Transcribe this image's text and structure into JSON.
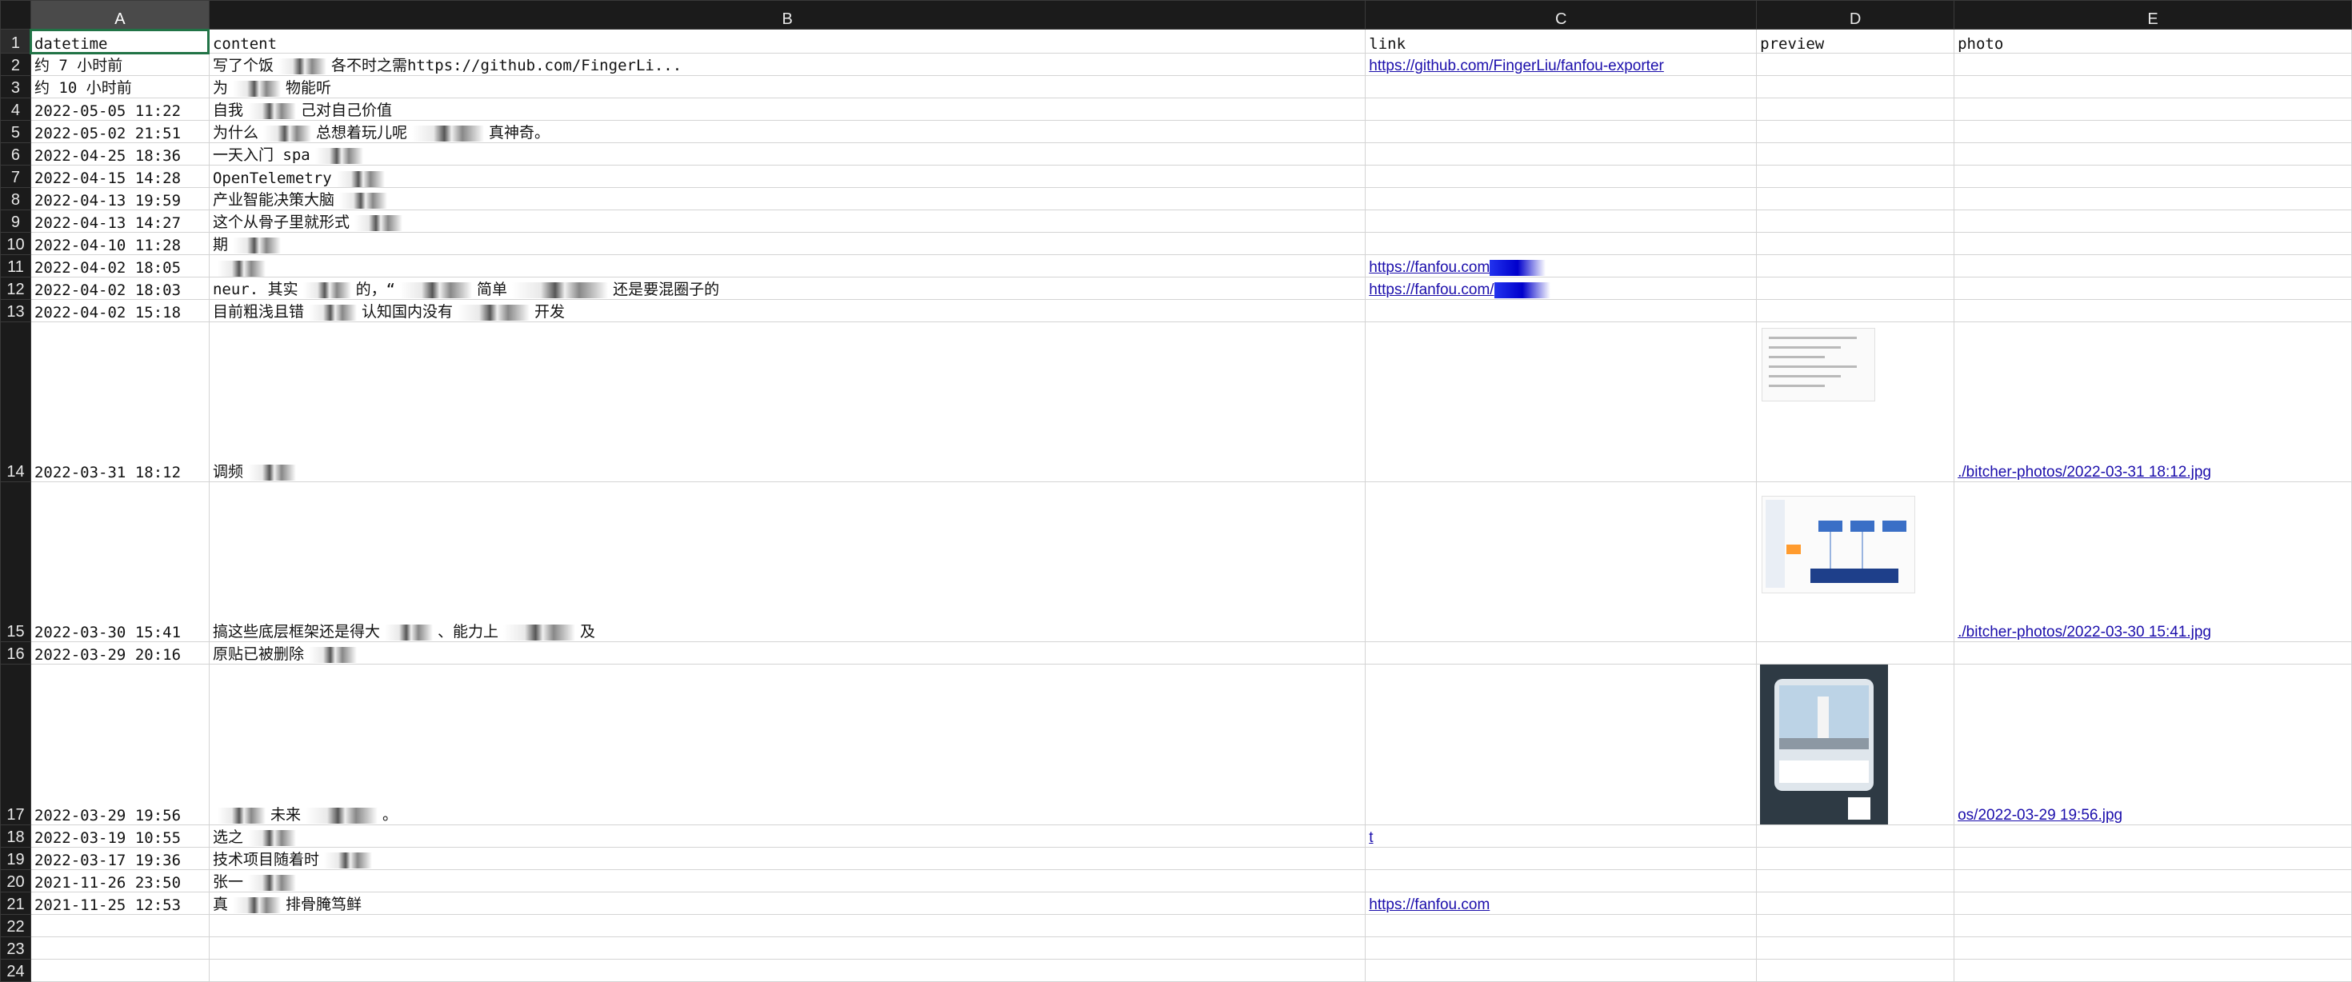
{
  "columns": [
    "A",
    "B",
    "C",
    "D",
    "E"
  ],
  "headers": [
    "datetime",
    "content",
    "link",
    "preview",
    "photo"
  ],
  "rows": [
    {
      "num": "2",
      "datetime": "约 7 小时前",
      "content": "写了个饭",
      "content_tail": "各不时之需https://github.com/FingerLi...",
      "link": "https://github.com/FingerLiu/fanfou-exporter",
      "photo": ""
    },
    {
      "num": "3",
      "datetime": "约 10 小时前",
      "content": "为",
      "content_tail": "物能听",
      "link": "",
      "photo": ""
    },
    {
      "num": "4",
      "datetime": "2022-05-05 11:22",
      "content": "自我",
      "content_tail": "己对自己价值",
      "link": "",
      "photo": ""
    },
    {
      "num": "5",
      "datetime": "2022-05-02 21:51",
      "content": "为什么",
      "content_tail": "总想着玩儿呢",
      "content_tail2": "真神奇。",
      "link": "",
      "photo": ""
    },
    {
      "num": "6",
      "datetime": "2022-04-25 18:36",
      "content": "一天入门 spa",
      "content_tail": "",
      "link": "",
      "photo": ""
    },
    {
      "num": "7",
      "datetime": "2022-04-15 14:28",
      "content": "OpenTelemetry",
      "content_tail": "",
      "link": "",
      "photo": ""
    },
    {
      "num": "8",
      "datetime": "2022-04-13 19:59",
      "content": "产业智能决策大脑",
      "content_tail": "",
      "link": "",
      "photo": ""
    },
    {
      "num": "9",
      "datetime": "2022-04-13 14:27",
      "content": "这个从骨子里就形式",
      "content_tail": "",
      "link": "",
      "photo": ""
    },
    {
      "num": "10",
      "datetime": "2022-04-10 11:28",
      "content": "期",
      "content_tail": "",
      "link": "",
      "photo": ""
    },
    {
      "num": "11",
      "datetime": "2022-04-02 18:05",
      "content": "",
      "content_tail": "",
      "link": "https://fanfou.com",
      "photo": ""
    },
    {
      "num": "12",
      "datetime": "2022-04-02 18:03",
      "content": "neur. 其实",
      "content_tail": "的，“",
      "content_tail2": "简单",
      "content_tail3": "还是要混圈子的",
      "link": "https://fanfou.com/",
      "photo": ""
    },
    {
      "num": "13",
      "datetime": "2022-04-02 15:18",
      "content": "目前粗浅且错",
      "content_tail": "认知国内没有",
      "content_tail2": "开发",
      "link": "",
      "photo": ""
    },
    {
      "num": "14",
      "datetime": "2022-03-31 18:12",
      "content": "调频",
      "content_tail": "",
      "link": "",
      "photo": "./bitcher-photos/2022-03-31 18:12.jpg"
    },
    {
      "num": "15",
      "datetime": "2022-03-30 15:41",
      "content": "搞这些底层框架还是得大",
      "content_tail": "、能力上",
      "content_tail2": "及",
      "link": "",
      "photo": "./bitcher-photos/2022-03-30 15:41.jpg"
    },
    {
      "num": "16",
      "datetime": "2022-03-29 20:16",
      "content": "原贴已被删除",
      "content_tail": "",
      "link": "",
      "photo": ""
    },
    {
      "num": "17",
      "datetime": "2022-03-29 19:56",
      "content": "",
      "content_tail": "未来",
      "content_tail2": "。",
      "link": "",
      "photo": "os/2022-03-29 19:56.jpg"
    },
    {
      "num": "18",
      "datetime": "2022-03-19 10:55",
      "content": "选之",
      "content_tail": "",
      "link": "t",
      "photo": ""
    },
    {
      "num": "19",
      "datetime": "2022-03-17 19:36",
      "content": "技术项目随着时",
      "content_tail": "",
      "link": "",
      "photo": ""
    },
    {
      "num": "20",
      "datetime": "2021-11-26 23:50",
      "content": "张一",
      "content_tail": "",
      "link": "",
      "photo": ""
    },
    {
      "num": "21",
      "datetime": "2021-11-25 12:53",
      "content": "真",
      "content_tail": "排骨腌笃鲜",
      "link": "https://fanfou.com",
      "photo": ""
    }
  ],
  "empty_rows": [
    "22",
    "23",
    "24"
  ],
  "colors": {
    "header_bg": "#1b1b1b",
    "selected_col_bg": "#4a4a4a",
    "link": "#1a0dab",
    "selection": "#217346",
    "grid": "#d4d4d4"
  }
}
